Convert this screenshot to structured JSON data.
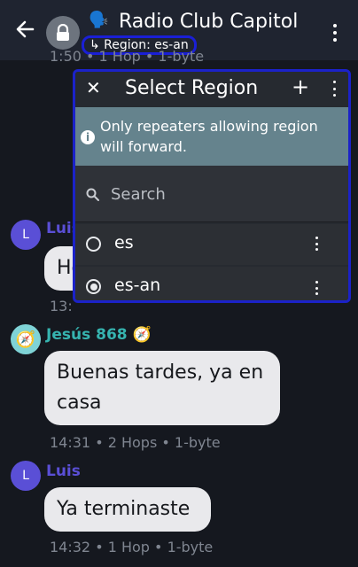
{
  "header": {
    "back_glyph": "←",
    "title_emoji": "🗣️",
    "title": "Radio Club Capitol",
    "region_chip": "↳ Region: es-an"
  },
  "chat": {
    "behind_meta_top": "1:50 • 1 Hop • 1-byte",
    "messages": [
      {
        "avatar": "L",
        "sender": "Luis",
        "text": "Hola",
        "meta": "13:"
      },
      {
        "avatar": "🧭",
        "sender": "Jesús 868 🧭",
        "text_line1": "Buenas tardes, ya en",
        "text_line2": "casa",
        "meta": "14:31 • 2 Hops • 1-byte"
      },
      {
        "avatar": "L",
        "sender": "Luis",
        "text": "Ya terminaste",
        "meta": "14:32 • 1 Hop • 1-byte"
      }
    ]
  },
  "dialog": {
    "close_glyph": "✕",
    "title": "Select Region",
    "add_glyph": "+",
    "info_icon": "i",
    "info_text": "Only repeaters allowing region will forward.",
    "search": {
      "placeholder": "Search",
      "value": ""
    },
    "items": [
      {
        "label": "es",
        "selected": false
      },
      {
        "label": "es-an",
        "selected": true
      }
    ]
  },
  "colors": {
    "accent_highlight": "#1b22c9",
    "luis_name": "#5a4fd6",
    "jesus_name": "#36b4b0",
    "info_bg": "#65838d"
  }
}
